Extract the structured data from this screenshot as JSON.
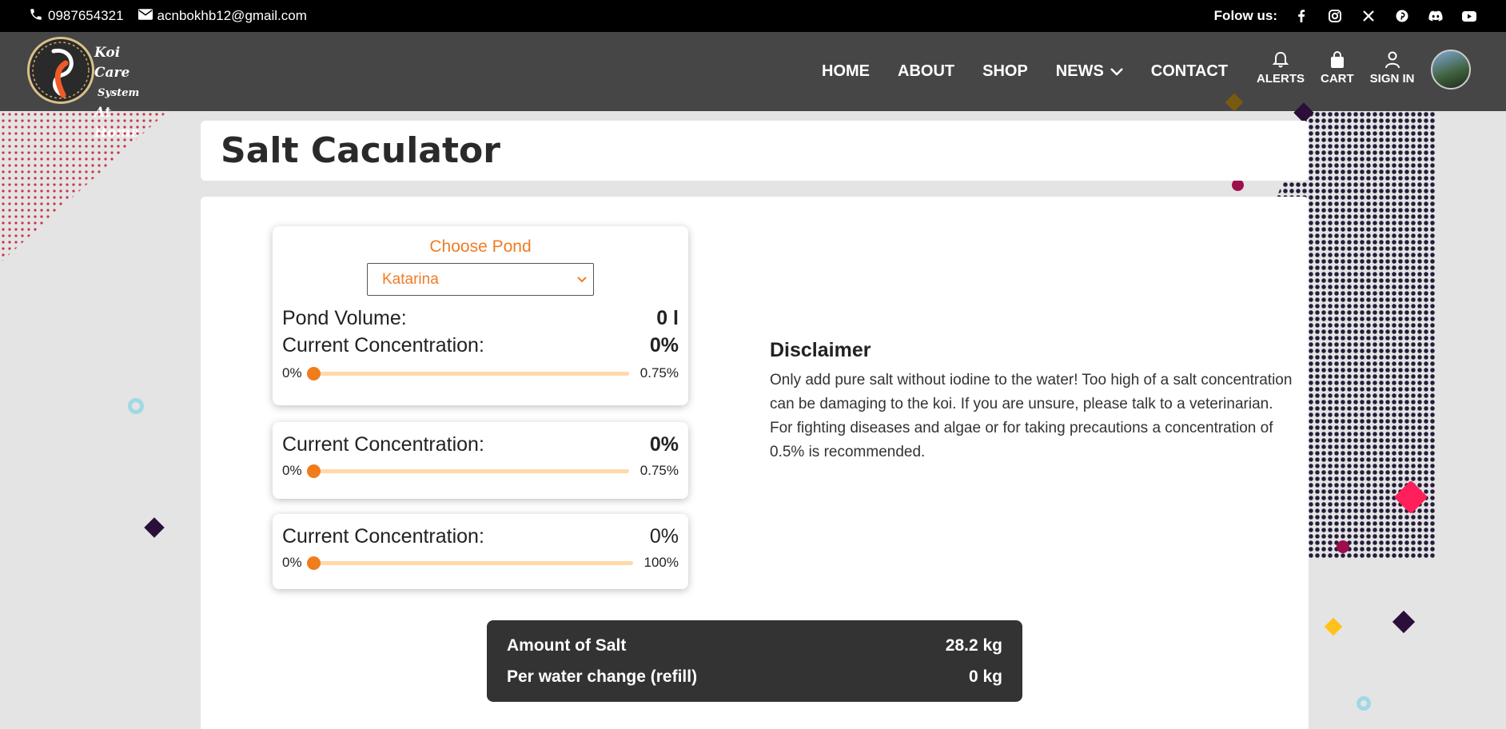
{
  "topbar": {
    "phone": "0987654321",
    "email": "acnbokhb12@gmail.com",
    "follow_label": "Folow us:",
    "social_icons": [
      "facebook-icon",
      "instagram-icon",
      "x-icon",
      "pinterest-icon",
      "discord-icon",
      "youtube-icon"
    ]
  },
  "brand": {
    "line1": "Koi Care",
    "line2": "System",
    "line3": "At Home"
  },
  "nav": {
    "home": "HOME",
    "about": "ABOUT",
    "shop": "SHOP",
    "news": "NEWS",
    "contact": "CONTACT",
    "alerts": "ALERTS",
    "cart": "CART",
    "signin": "SIGN IN"
  },
  "page": {
    "title": "Salt Caculator"
  },
  "calculator": {
    "choose_label": "Choose Pond",
    "selected_pond": "Katarina",
    "pond_volume_label": "Pond Volume:",
    "pond_volume_value": "0 l",
    "sliders": [
      {
        "label": "Current Concentration:",
        "value": "0%",
        "min": "0%",
        "max": "0.75%",
        "level": 0
      },
      {
        "label": "Current Concentration:",
        "value": "0%",
        "min": "0%",
        "max": "0.75%",
        "level": 0
      },
      {
        "label": "Current Concentration:",
        "value": "0%",
        "min": "0%",
        "max": "100%",
        "level": 0
      }
    ]
  },
  "disclaimer": {
    "title": "Disclaimer",
    "text": "Only add pure salt without iodine to the water! Too high of a salt concentration can be damaging to the koi. If you are unsure, please talk to a veterinarian. For fighting diseases and algae or for taking precautions a concentration of 0.5% is recommended."
  },
  "result": {
    "amount_label": "Amount of Salt",
    "amount_value": "28.2 kg",
    "refill_label": "Per water change (refill)",
    "refill_value": "0 kg"
  },
  "colors": {
    "accent": "#f07c24",
    "topbar": "#000000",
    "navbar": "#464646",
    "result_bg": "#333333"
  }
}
